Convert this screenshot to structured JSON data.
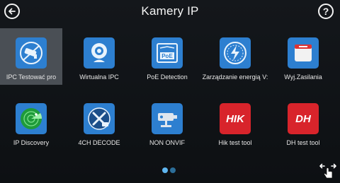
{
  "header": {
    "title": "Kamery IP",
    "back_icon": "arrow-left-icon",
    "help_icon": "question-mark-icon",
    "help_glyph": "?"
  },
  "apps": [
    {
      "label": "IPC Testować pro",
      "icon": "camera-test-icon",
      "selected": true
    },
    {
      "label": "Wirtualna IPC",
      "icon": "webcam-icon",
      "selected": false
    },
    {
      "label": "PoE Detection",
      "icon": "poe-icon",
      "icon_text": "PoE",
      "selected": false
    },
    {
      "label": "Zarządzanie energią V:",
      "icon": "energy-management-icon",
      "selected": false
    },
    {
      "label": "Wyj.Zasilania",
      "icon": "power-switch-icon",
      "selected": false
    },
    {
      "label": "IP Discovery",
      "icon": "radar-icon",
      "selected": false
    },
    {
      "label": "4CH DECODE",
      "icon": "decode-tools-icon",
      "selected": false
    },
    {
      "label": "NON ONVIF",
      "icon": "cctv-camera-icon",
      "selected": false
    },
    {
      "label": "Hik test tool",
      "icon": "hik-logo-icon",
      "icon_text": "HIK",
      "selected": false
    },
    {
      "label": "DH test tool",
      "icon": "dh-logo-icon",
      "icon_text": "DH",
      "selected": false
    }
  ],
  "pagination": {
    "total": 2,
    "current": 1
  },
  "colors": {
    "background": "#0f1216",
    "icon_blue": "#2d7fd0",
    "selected_tile": "#4a4f55",
    "hik_red": "#d8242b"
  }
}
